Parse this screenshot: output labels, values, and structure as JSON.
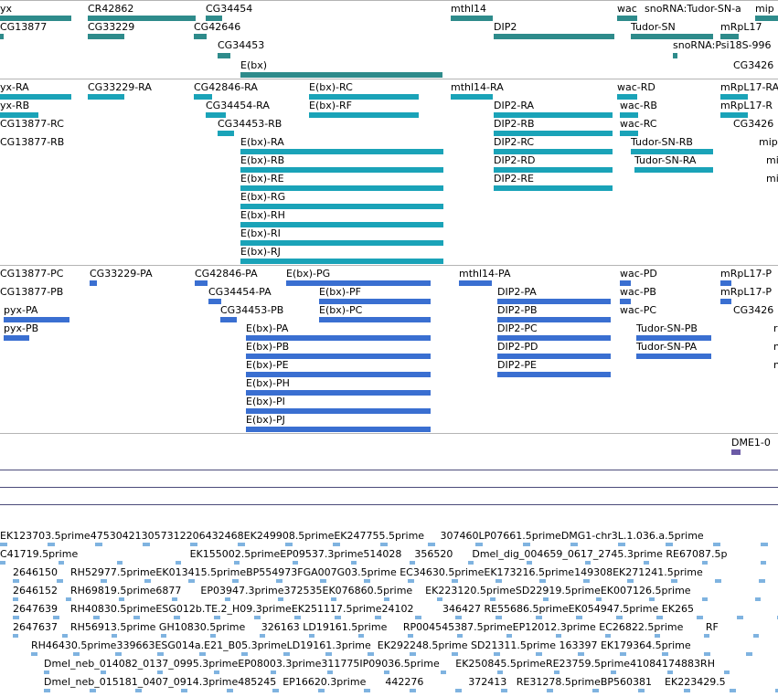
{
  "colors": {
    "gene_track": "#2e8b8b",
    "transcript_track": "#1aa3b8",
    "cds_track": "#3a6fd1",
    "est_track": "#7fb3e0",
    "other_feature": "#6b5aa6",
    "separator": "#b4b4b4",
    "wig_lines": "#4b4b7a"
  },
  "gene_track": {
    "labels": [
      "yx",
      "CR42862",
      "CG34454",
      "mthl14",
      "wac",
      "snoRNA:Tudor-SN-a",
      "mip",
      "CG13877",
      "CG33229",
      "CG42646",
      "DIP2",
      "Tudor-SN",
      "mRpL17",
      "CG34453",
      "snoRNA:Psi18S-996",
      "E(bx)",
      "CG3426"
    ]
  },
  "transcript_track": {
    "labels": [
      "yx-RA",
      "CG33229-RA",
      "CG42846-RA",
      "E(bx)-RC",
      "mthl14-RA",
      "wac-RD",
      "mRpL17-RA",
      "yx-RB",
      "CG34454-RA",
      "E(bx)-RF",
      "DIP2-RA",
      "wac-RB",
      "mRpL17-R",
      "CG13877-RC",
      "CG34453-RB",
      "DIP2-RB",
      "wac-RC",
      "CG3426",
      "CG13877-RB",
      "E(bx)-RA",
      "DIP2-RC",
      "Tudor-SN-RB",
      "mip",
      "E(bx)-RB",
      "DIP2-RD",
      "Tudor-SN-RA",
      "mi",
      "E(bx)-RE",
      "DIP2-RE",
      "mi",
      "E(bx)-RG",
      "E(bx)-RH",
      "E(bx)-RI",
      "E(bx)-RJ"
    ]
  },
  "cds_track": {
    "labels": [
      "CG13877-PC",
      "CG33229-PA",
      "CG42846-PA",
      "E(bx)-PG",
      "mthl14-PA",
      "wac-PD",
      "mRpL17-P",
      "CG13877-PB",
      "CG34454-PA",
      "E(bx)-PF",
      "DIP2-PA",
      "wac-PB",
      "mRpL17-P",
      "pyx-PA",
      "CG34453-PB",
      "E(bx)-PC",
      "DIP2-PB",
      "wac-PC",
      "CG3426",
      "pyx-PB",
      "E(bx)-PA",
      "DIP2-PC",
      "Tudor-SN-PB",
      "r",
      "E(bx)-PB",
      "DIP2-PD",
      "Tudor-SN-PA",
      "n",
      "E(bx)-PE",
      "DIP2-PE",
      "n",
      "E(bx)-PH",
      "E(bx)-PI",
      "E(bx)-PJ"
    ]
  },
  "other_track": {
    "labels": [
      "DME1-0"
    ]
  },
  "est_track": {
    "rows": [
      "EK123703.5prime475304213057312206432468EK249908.5primeEK247755.5prime     307460LP07661.5primeDMG1-chr3L.1.036.a.5prime",
      "C41719.5prime                                   EK155002.5primeEP09537.3prime514028    356520      Dmel_dig_004659_0617_2745.3prime RE67087.5p",
      "2646150    RH52977.5primeEK013415.5primeBP554973FGA007G03.5prime EC34630.5primeEK173216.5prime149308EK271241.5prime",
      "2646152    RH69819.5prime6877      EP03947.3prime372535EK076860.5prime    EK223120.5primeSD22919.5primeEK007126.5prime",
      "2647639    RH40830.5primeESG012b.TE.2_H09.3primeEK251117.5prime24102         346427 RE55686.5primeEK054947.5prime EK265",
      "2647637    RH56913.5prime GH10830.5prime     326163 LD19161.5prime     RP004545387.5primeEP12012.3prime EC26822.5prime       RF",
      "RH46430.5prime339663ESG014a.E21_B05.3primeLD19161.3prime  EK292248.5prime SD21311.5prime 163397 EK179364.5prime",
      "Dmel_neb_014082_0137_0995.3primeEP08003.3prime311775IP09036.5prime     EK250845.5primeRE23759.5prime41084174883RH",
      "Dmel_neb_015181_0407_0914.3prime485245  EP16620.3prime      442276              372413   RE31278.5primeBP560381    EK223429.5"
    ]
  }
}
